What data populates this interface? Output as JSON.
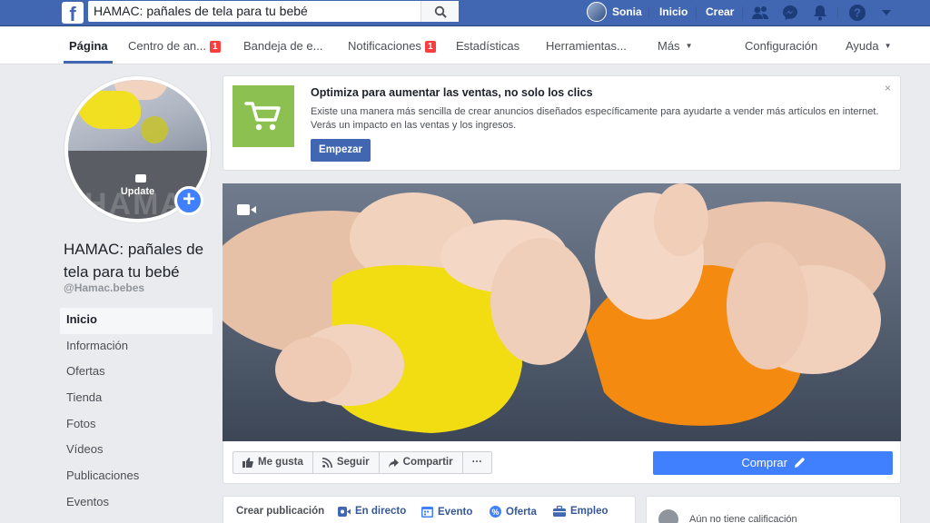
{
  "topbar": {
    "logo": "f",
    "search_value": "HAMAC: pañales de tela para tu bebé",
    "user": "Sonia",
    "home": "Inicio",
    "create": "Crear"
  },
  "subnav": {
    "items": [
      {
        "label": "Página"
      },
      {
        "label": "Centro de an...",
        "badge": "1"
      },
      {
        "label": "Bandeja de e..."
      },
      {
        "label": "Notificaciones",
        "badge": "1"
      },
      {
        "label": "Estadísticas"
      },
      {
        "label": "Herramientas..."
      },
      {
        "label": "Más"
      },
      {
        "label": "Configuración"
      },
      {
        "label": "Ayuda"
      }
    ]
  },
  "profile": {
    "update_label": "Update",
    "watermark": "HAMAC",
    "add_symbol": "+",
    "name": "HAMAC: pañales de tela para tu bebé",
    "handle": "@Hamac.bebes"
  },
  "leftnav": [
    {
      "label": "Inicio"
    },
    {
      "label": "Información"
    },
    {
      "label": "Ofertas"
    },
    {
      "label": "Tienda"
    },
    {
      "label": "Fotos"
    },
    {
      "label": "Vídeos"
    },
    {
      "label": "Publicaciones"
    },
    {
      "label": "Eventos"
    }
  ],
  "ad": {
    "title": "Optimiza para aumentar las ventas, no solo los clics",
    "body": "Existe una manera más sencilla de crear anuncios diseñados específicamente para ayudarte a vender más artículos en internet. Verás un impacto en las ventas y los ingresos.",
    "button": "Empezar",
    "close": "×"
  },
  "actions": {
    "like": "Me gusta",
    "follow": "Seguir",
    "share": "Compartir",
    "more": "···",
    "buy": "Comprar"
  },
  "composer": {
    "create_post": "Crear publicación",
    "live": "En directo",
    "event": "Evento",
    "offer": "Oferta",
    "job": "Empleo"
  },
  "rating": {
    "text": "Aún no tiene calificación"
  },
  "colors": {
    "brand_blue": "#4267b2",
    "button_blue": "#4080ff",
    "ad_green": "#8cc152",
    "badge_red": "#fa3e3e"
  }
}
